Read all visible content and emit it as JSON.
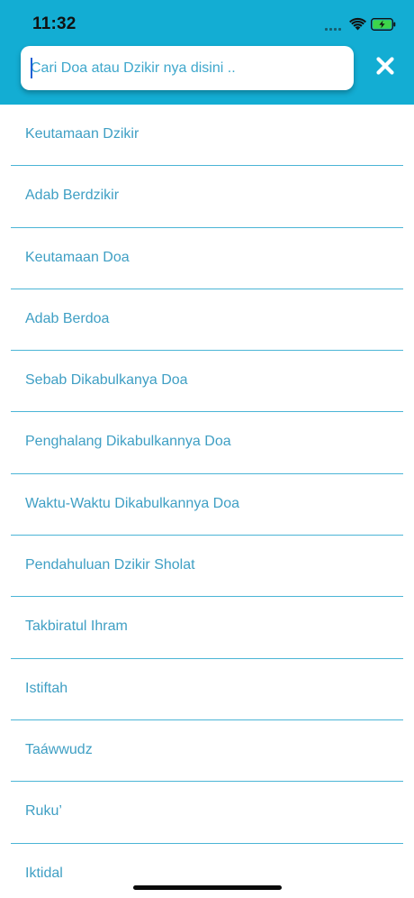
{
  "status_bar": {
    "time": "11:32",
    "signal_icon": "cellular-signal-icon",
    "wifi_icon": "wifi-icon",
    "battery_icon": "battery-charging-icon"
  },
  "colors": {
    "header_bg": "#13add3",
    "item_text": "#3f9fc4",
    "divider": "#4bb5d6",
    "battery_fill": "#3dd44a"
  },
  "search": {
    "value": "",
    "placeholder": "Cari Doa atau Dzikir nya disini ..",
    "close_icon": "close-x-icon"
  },
  "list": {
    "items": [
      "Keutamaan Dzikir",
      "Adab Berdzikir",
      "Keutamaan Doa",
      "Adab Berdoa",
      "Sebab Dikabulkanya Doa",
      "Penghalang Dikabulkannya Doa",
      "Waktu-Waktu Dikabulkannya Doa",
      "Pendahuluan Dzikir Sholat",
      "Takbiratul Ihram",
      "Istiftah",
      "Taáwwudz",
      "Ruku’",
      "Iktidal"
    ]
  }
}
